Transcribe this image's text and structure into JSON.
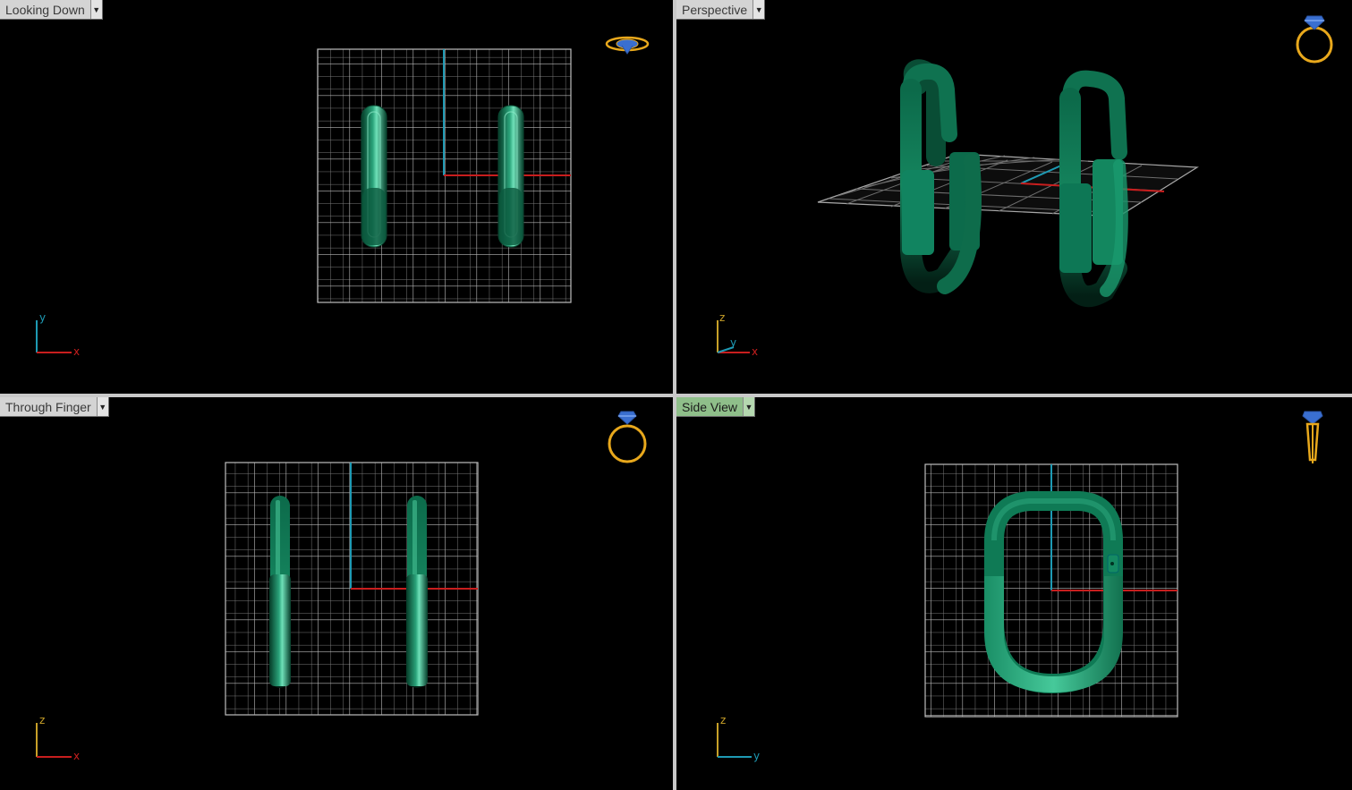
{
  "viewports": {
    "top_left": {
      "title": "Looking Down",
      "axis_v": "y",
      "axis_h": "x"
    },
    "top_right": {
      "title": "Perspective",
      "axis_v": "z",
      "axis_mid": "y",
      "axis_h": "x"
    },
    "bottom_left": {
      "title": "Through Finger",
      "axis_v": "z",
      "axis_h": "x"
    },
    "bottom_right": {
      "title": "Side View",
      "axis_v": "z",
      "axis_h": "y"
    }
  },
  "icons": {
    "dropdown": "chevron-down-icon",
    "nav": "ring-view-icon"
  },
  "colors": {
    "background": "#000000",
    "grid": "#8c8c8c",
    "axis_x": "#c81e1e",
    "axis_y": "#1e9ab4",
    "axis_z": "#c8a028",
    "model": "#0f7a55",
    "active_tab": "#8fbf8a",
    "nav_icon": "#e8a81c"
  }
}
